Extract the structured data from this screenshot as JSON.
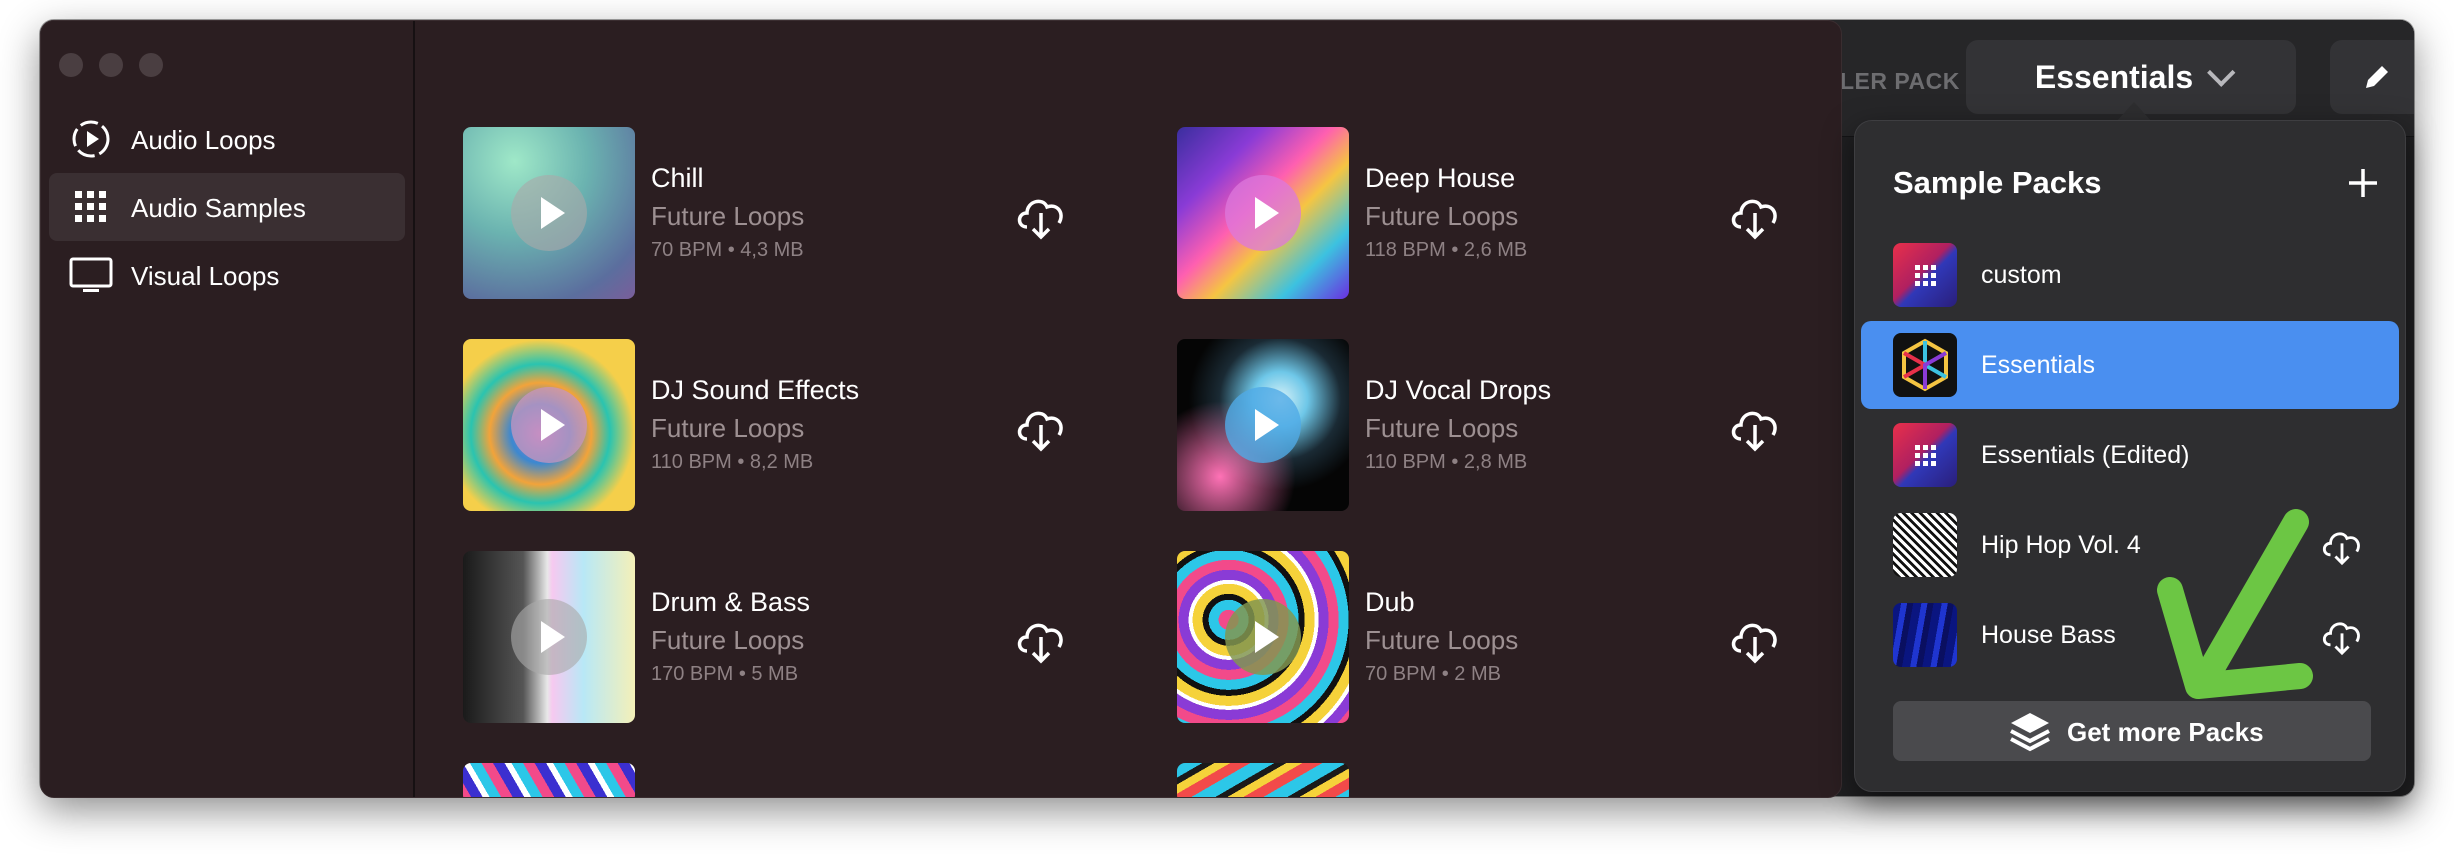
{
  "background_app": {
    "sampler_fragment": "LER PACK",
    "selector": {
      "label": "Essentials",
      "icon": "chevron-down-icon"
    },
    "edit_icon": "pencil-icon"
  },
  "sidebar": {
    "items": [
      {
        "label": "Audio Loops",
        "icon": "audio-loops-icon",
        "active": false
      },
      {
        "label": "Audio Samples",
        "icon": "grid-icon",
        "active": true
      },
      {
        "label": "Visual Loops",
        "icon": "monitor-icon",
        "active": false
      }
    ]
  },
  "packs_grid": {
    "items": [
      {
        "title": "Chill",
        "source": "Future Loops",
        "meta": "70 BPM • 4,3 MB"
      },
      {
        "title": "Deep House",
        "source": "Future Loops",
        "meta": "118 BPM • 2,6 MB"
      },
      {
        "title": "DJ Sound Effects",
        "source": "Future Loops",
        "meta": "110 BPM • 8,2 MB"
      },
      {
        "title": "DJ Vocal Drops",
        "source": "Future Loops",
        "meta": "110 BPM • 2,8 MB"
      },
      {
        "title": "Drum & Bass",
        "source": "Future Loops",
        "meta": "170 BPM • 5 MB"
      },
      {
        "title": "Dub",
        "source": "Future Loops",
        "meta": "70 BPM • 2 MB"
      }
    ]
  },
  "popover": {
    "title": "Sample Packs",
    "add_icon": "plus-icon",
    "packs": [
      {
        "name": "custom",
        "selected": false,
        "downloadable": false
      },
      {
        "name": "Essentials",
        "selected": true,
        "downloadable": false
      },
      {
        "name": "Essentials (Edited)",
        "selected": false,
        "downloadable": false
      },
      {
        "name": "Hip Hop Vol. 4",
        "selected": false,
        "downloadable": true
      },
      {
        "name": "House Bass",
        "selected": false,
        "downloadable": true
      }
    ],
    "get_more_label": "Get more Packs"
  },
  "colors": {
    "selection_blue": "#4a8ff0",
    "annotation_arrow": "#6cc644",
    "window_bg": "#2b1e21"
  }
}
